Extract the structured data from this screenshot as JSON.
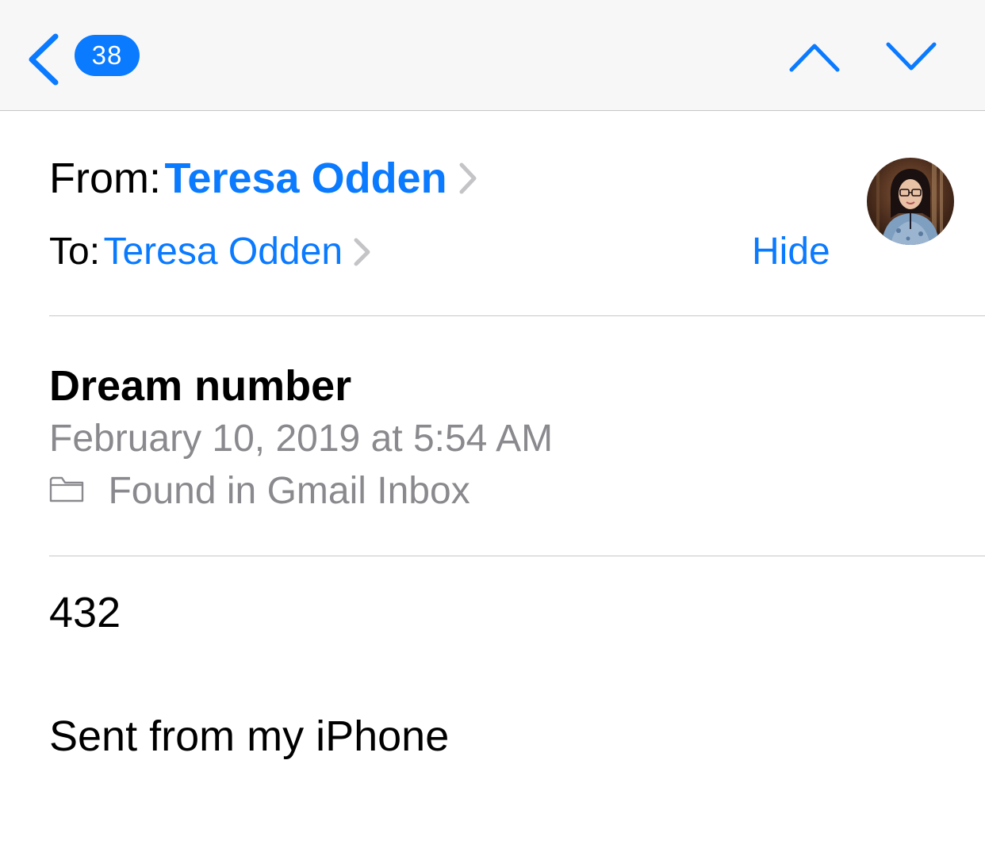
{
  "navbar": {
    "back_count": "38",
    "back_icon": "chevron-left-icon",
    "prev_icon": "chevron-up-icon",
    "next_icon": "chevron-down-icon"
  },
  "header": {
    "from_label": "From:",
    "from_name": "Teresa Odden",
    "to_label": "To:",
    "to_name": "Teresa Odden",
    "hide_label": "Hide",
    "subject": "Dream number",
    "date": "February 10, 2019 at 5:54 AM",
    "folder_icon": "folder-icon",
    "folder_text": "Found in Gmail Inbox"
  },
  "body": {
    "lines": [
      "432",
      "Sent from my iPhone"
    ]
  },
  "colors": {
    "accent": "#0a7aff",
    "secondary_text": "#8a8a8e",
    "navbar_bg": "#f7f7f7"
  }
}
